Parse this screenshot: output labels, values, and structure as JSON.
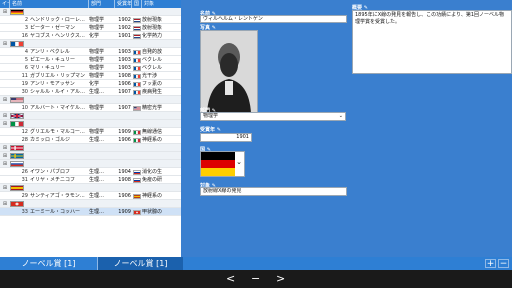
{
  "table": {
    "headers": [
      "イー",
      "名前",
      "部門",
      "受賞年",
      "国",
      "対象"
    ],
    "rows": [
      {
        "kind": "group",
        "expand": "⊞",
        "flag": "de",
        "sel": false
      },
      {
        "kind": "item",
        "n": "2",
        "name": "ヘンドリック・ローレ…",
        "dept": "物理学",
        "year": "1902",
        "cflag": "nl",
        "obj": "放射現象"
      },
      {
        "kind": "item",
        "n": "3",
        "name": "ピーター・ゼーマン",
        "dept": "物理学",
        "year": "1902",
        "cflag": "nl",
        "obj": "放射現象"
      },
      {
        "kind": "item",
        "n": "16",
        "name": "ヤコブス・ヘンリクス…",
        "dept": "化学",
        "year": "1901",
        "cflag": "nl",
        "obj": "化学熱力"
      },
      {
        "kind": "group",
        "expand": "⊞",
        "flag": "fr",
        "sel": false
      },
      {
        "kind": "item",
        "n": "4",
        "name": "アンリ・ベクレル",
        "dept": "物理学",
        "year": "1903",
        "cflag": "fr",
        "obj": "自発的放"
      },
      {
        "kind": "item",
        "n": "5",
        "name": "ピエール・キュリー",
        "dept": "物理学",
        "year": "1903",
        "cflag": "fr",
        "obj": "ベクレル"
      },
      {
        "kind": "item",
        "n": "6",
        "name": "マリ・キュリー",
        "dept": "物理学",
        "year": "1903",
        "cflag": "fr",
        "obj": "ベクレル"
      },
      {
        "kind": "item",
        "n": "11",
        "name": "ガブリエル・リップマン",
        "dept": "物理学",
        "year": "1908",
        "cflag": "fr",
        "obj": "光干渉"
      },
      {
        "kind": "item",
        "n": "19",
        "name": "アンリ・モアッサン",
        "dept": "化学",
        "year": "1906",
        "cflag": "fr",
        "obj": "フッ素の"
      },
      {
        "kind": "item",
        "n": "30",
        "name": "シャルル・ルイ・アル…",
        "dept": "生理…",
        "year": "1907",
        "cflag": "fr",
        "obj": "疾病発生"
      },
      {
        "kind": "group",
        "expand": "⊞",
        "flag": "us",
        "sel": false
      },
      {
        "kind": "item",
        "n": "10",
        "name": "アルバート・マイケル…",
        "dept": "物理学",
        "year": "1907",
        "cflag": "us",
        "obj": "精密光学"
      },
      {
        "kind": "group",
        "expand": "⊞",
        "flag": "uk",
        "sel": false
      },
      {
        "kind": "group",
        "expand": "⊞",
        "flag": "it",
        "sel": false
      },
      {
        "kind": "item",
        "n": "12",
        "name": "グリエルモ・マルコー…",
        "dept": "物理学",
        "year": "1909",
        "cflag": "it",
        "obj": "無線通信"
      },
      {
        "kind": "item",
        "n": "28",
        "name": "カミッロ・ゴルジ",
        "dept": "生理…",
        "year": "1906",
        "cflag": "it",
        "obj": "神経系の"
      },
      {
        "kind": "group",
        "expand": "⊞",
        "flag": "dk",
        "sel": false
      },
      {
        "kind": "group",
        "expand": "⊞",
        "flag": "se",
        "sel": false
      },
      {
        "kind": "group",
        "expand": "⊞",
        "flag": "ru",
        "sel": false
      },
      {
        "kind": "item",
        "n": "26",
        "name": "イワン・パブロフ",
        "dept": "生理…",
        "year": "1904",
        "cflag": "ru",
        "obj": "消化の生"
      },
      {
        "kind": "item",
        "n": "31",
        "name": "イリヤ・メチニコフ",
        "dept": "生理…",
        "year": "1908",
        "cflag": "ru",
        "obj": "免疫の研"
      },
      {
        "kind": "group",
        "expand": "⊞",
        "flag": "es",
        "sel": false
      },
      {
        "kind": "item",
        "n": "29",
        "name": "サンティアゴ・ラモン…",
        "dept": "生理…",
        "year": "1906",
        "cflag": "es",
        "obj": "神経系の"
      },
      {
        "kind": "group",
        "expand": "⊞",
        "flag": "ch",
        "sel": false
      },
      {
        "kind": "item",
        "n": "33",
        "name": "エーミール・コッハー",
        "dept": "生理…",
        "year": "1909",
        "cflag": "ch",
        "obj": "甲状腺の",
        "sel": true
      }
    ]
  },
  "tabs": {
    "tab1": "ノーベル賞 [1]",
    "tab2": "ノーベル賞 [1]",
    "plus": "+",
    "minus": "−"
  },
  "form": {
    "name_label": "名前",
    "name_value": "ヴィルヘルム・レントゲン",
    "photo_label": "写真",
    "dept_label": "部門",
    "dept_value": "物理学",
    "year_label": "受賞年",
    "year_value": "1901",
    "country_label": "国",
    "object_label": "対象",
    "object_value": "放射線X線の発見",
    "summary_label": "概要",
    "summary_value": "1895年にX線の発見を報告し、この功績により、第1回ノーベル物理学賞を受賞した。"
  },
  "bottom": {
    "prev": "<",
    "menu": "−",
    "next": ">"
  },
  "colors": {
    "accent": "#3a7fcf",
    "header": "#2e7fd4",
    "selected_row": "#cfe1f6"
  },
  "icons": {
    "expand": "plus-box-icon",
    "edit": "edit-icon",
    "dropdown": "chevron-down-icon"
  }
}
